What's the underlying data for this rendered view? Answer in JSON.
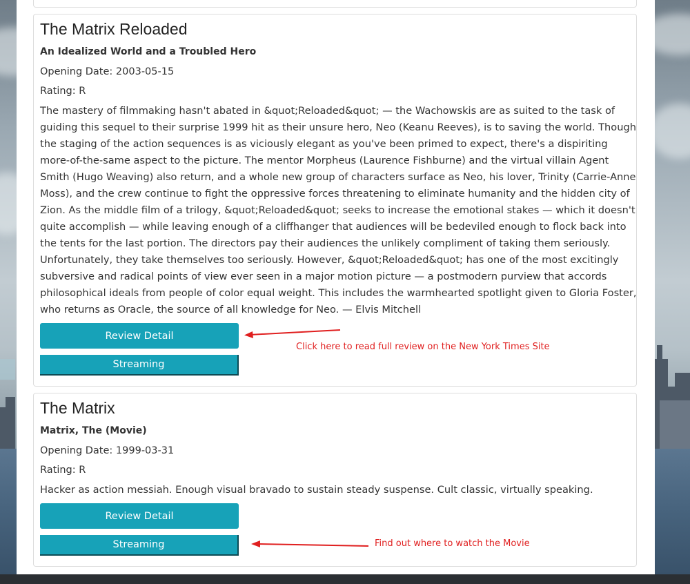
{
  "movies": [
    {
      "title": "The Matrix Reloaded",
      "headline": "An Idealized World and a Troubled Hero",
      "opening_date": "Opening Date: 2003-05-15",
      "rating": "Rating: R",
      "summary": "The mastery of filmmaking hasn't abated in &quot;Reloaded&quot; — the Wachowskis are as suited to the task of guiding this sequel to their surprise 1999 hit as their unsure hero, Neo (Keanu Reeves), is to saving the world. Though the staging of the action sequences is as viciously elegant as you've been primed to expect, there's a dispiriting more-of-the-same aspect to the picture. The mentor Morpheus (Laurence Fishburne) and the virtual villain Agent Smith (Hugo Weaving) also return, and a whole new group of characters surface as Neo, his lover, Trinity (Carrie-Anne Moss), and the crew continue to fight the oppressive forces threatening to eliminate humanity and the hidden city of Zion. As the middle film of a trilogy, &quot;Reloaded&quot; seeks to increase the emotional stakes — which it doesn't quite accomplish — while leaving enough of a cliffhanger that audiences will be bedeviled enough to flock back into the tents for the last portion. The directors pay their audiences the unlikely compliment of taking them seriously. Unfortunately, they take themselves too seriously. However, &quot;Reloaded&quot; has one of the most excitingly subversive and radical points of view ever seen in a major motion picture — a postmodern purview that accords philosophical ideals from people of color equal weight. This includes the warmhearted spotlight given to Gloria Foster, who returns as Oracle, the source of all knowledge for Neo. — Elvis Mitchell",
      "review_button": "Review Detail",
      "streaming_button": "Streaming"
    },
    {
      "title": "The Matrix",
      "headline": "Matrix, The (Movie)",
      "opening_date": "Opening Date: 1999-03-31",
      "rating": "Rating: R",
      "summary": "Hacker as action messiah. Enough visual bravado to sustain steady suspense. Cult classic, virtually speaking.",
      "review_button": "Review Detail",
      "streaming_button": "Streaming"
    }
  ],
  "annotations": {
    "review_hint": "Click here to read full review on the New York Times Site",
    "streaming_hint": "Find out where to watch the Movie",
    "color": "#e01f1f"
  },
  "colors": {
    "button": "#17a2b8",
    "card_border": "#dddddd"
  }
}
